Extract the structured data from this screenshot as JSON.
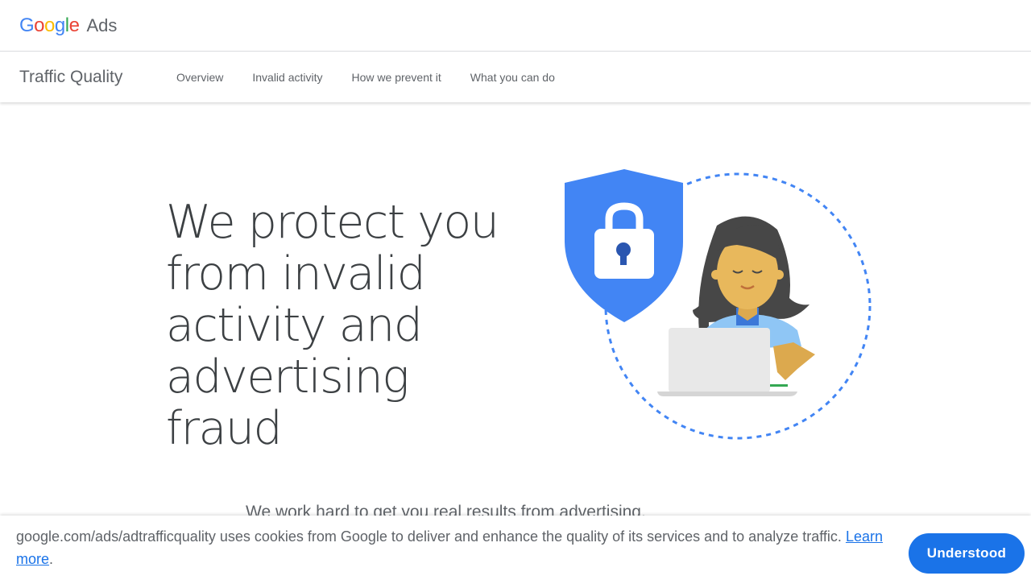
{
  "header": {
    "logo_letters": [
      "G",
      "o",
      "o",
      "g",
      "l",
      "e"
    ],
    "logo_colors": [
      "#4285f4",
      "#ea4335",
      "#fbbc04",
      "#4285f4",
      "#34a853",
      "#ea4335"
    ],
    "product": "Ads"
  },
  "subnav": {
    "title": "Traffic Quality",
    "links": [
      "Overview",
      "Invalid activity",
      "How we prevent it",
      "What you can do"
    ]
  },
  "hero": {
    "heading_lines": [
      "We protect you",
      "from invalid",
      "activity and",
      "advertising fraud"
    ],
    "illustration": "shield-lock-person-laptop"
  },
  "intro": {
    "text": "We work hard to get you real results from advertising."
  },
  "cookie": {
    "text": "google.com/ads/adtrafficquality uses cookies from Google to deliver and enhance the quality of its services and to analyze traffic.",
    "link_label": "Learn more",
    "suffix": ".",
    "button_label": "Understood"
  },
  "colors": {
    "accent": "#1a73e8",
    "shield": "#4285f4",
    "text": "#5f6368",
    "heading": "#3c4043"
  }
}
